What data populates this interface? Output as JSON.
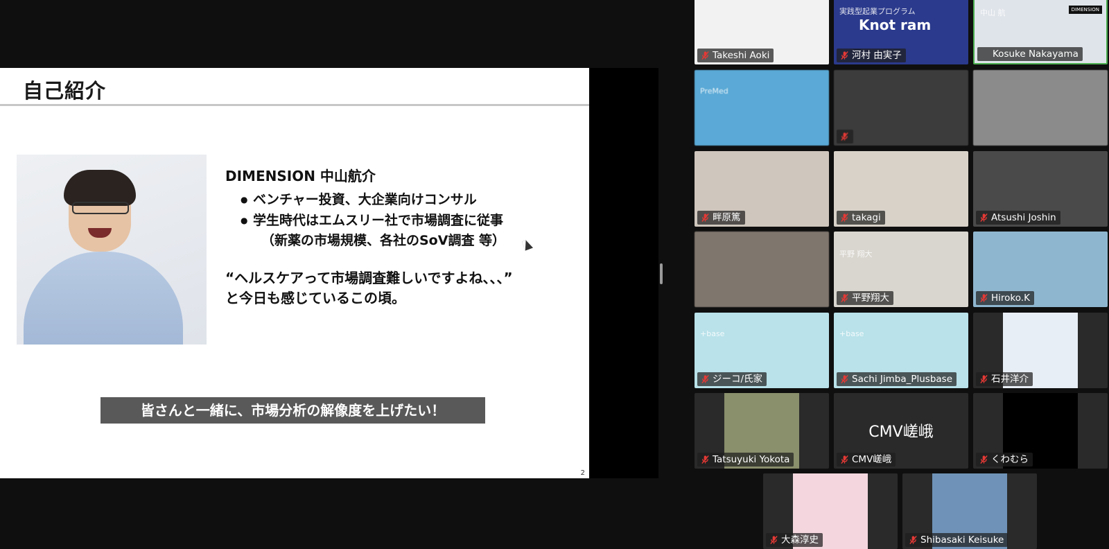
{
  "slide": {
    "title": "自己紹介",
    "name_line": "DIMENSION 中山航介",
    "bullets": [
      "ベンチャー投資、大企業向けコンサル",
      "学生時代はエムスリー社で市場調査に従事"
    ],
    "bullet_sub": "（新薬の市場規模、各社のSoV調査 等）",
    "quote_line1": "“ヘルスケアって市場調査難しいですよね、、、”",
    "quote_line2": "と今日も感じているこの頃。",
    "banner": "皆さんと一緒に、市場分析の解像度を上げたい！",
    "page_number": "2"
  },
  "participants": [
    {
      "name": "Takeshi Aoki",
      "muted": true,
      "bg": "#f2f2f2",
      "active": false
    },
    {
      "name": "河村 由実子",
      "muted": true,
      "bg": "#2b3a8c",
      "active": false,
      "overlay": "Knot   ram",
      "overlay_small": "実践型起業プログラム"
    },
    {
      "name": "Kosuke Nakayama",
      "muted": false,
      "bg": "#dfe4ea",
      "active": true,
      "overlay_logo": "DIMENSION",
      "overlay_small": "中山 航"
    },
    {
      "name": "",
      "muted": false,
      "bg": "#5aa9d6",
      "active": false,
      "overlay_small": "PreMed"
    },
    {
      "name": "",
      "muted": true,
      "bg": "#3c3c3c",
      "active": false
    },
    {
      "name": "",
      "muted": false,
      "bg": "#8b8b8b",
      "active": false
    },
    {
      "name": "畔原篤",
      "muted": true,
      "bg": "#cfc6bd",
      "active": false
    },
    {
      "name": "takagi",
      "muted": true,
      "bg": "#d8d2c9",
      "active": false
    },
    {
      "name": "Atsushi Joshin",
      "muted": true,
      "bg": "#4a4a4a",
      "active": false
    },
    {
      "name": "",
      "muted": false,
      "bg": "#7f766d",
      "active": false
    },
    {
      "name": "平野翔大",
      "muted": true,
      "bg": "#d9d6cf",
      "active": false,
      "overlay_small": "平野 翔大"
    },
    {
      "name": "Hiroko.K",
      "muted": true,
      "bg": "#8fb6cf",
      "active": false
    },
    {
      "name": "ジーコ/氏家",
      "muted": true,
      "bg": "#b9e2ea",
      "active": false,
      "overlay_small": "+base"
    },
    {
      "name": "Sachi Jimba_Plusbase",
      "muted": true,
      "bg": "#b9e2ea",
      "active": false,
      "overlay_small": "+base"
    },
    {
      "name": "石井洋介",
      "muted": true,
      "bg": "#2a2a2a",
      "active": false,
      "inner": "#e8eef5"
    },
    {
      "name": "Tatsuyuki Yokota",
      "muted": true,
      "bg": "#2a2a2a",
      "active": false,
      "inner": "#8a8f6c"
    },
    {
      "name": "CMV嵯峨",
      "muted": true,
      "bg": "#2a2a2a",
      "active": false,
      "big": "CMV嵯峨"
    },
    {
      "name": "くわむら",
      "muted": true,
      "bg": "#2a2a2a",
      "active": false,
      "inner": "#000000"
    },
    {
      "name": "大森淳史",
      "muted": true,
      "bg": "#2a2a2a",
      "active": false,
      "inner": "#f3d6de"
    },
    {
      "name": "Shibasaki Keisuke",
      "muted": true,
      "bg": "#2a2a2a",
      "active": false,
      "inner": "#6f93b8"
    }
  ]
}
